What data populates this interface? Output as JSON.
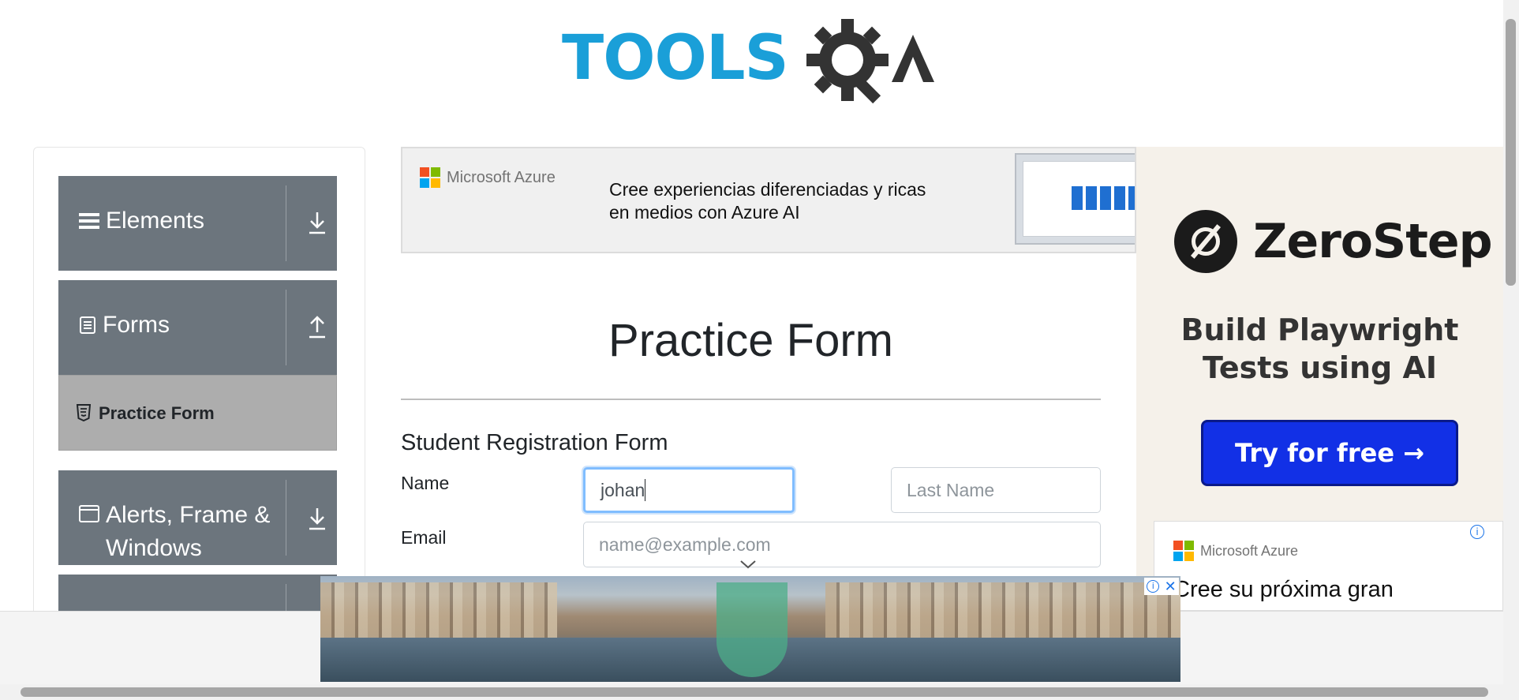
{
  "header": {
    "logo_text": "TOOLS",
    "logo_suffix": "QA"
  },
  "sidebar": {
    "groups": [
      {
        "label": "Elements",
        "icon": "hamburger-icon",
        "arrow": "download-arrow-icon"
      },
      {
        "label": "Forms",
        "icon": "document-icon",
        "arrow": "upload-arrow-icon"
      },
      {
        "label": "Alerts, Frame & Windows",
        "label_line1": "Alerts, Frame &",
        "label_line2": "Windows",
        "icon": "window-icon",
        "arrow": "download-arrow-icon"
      }
    ],
    "active_item": {
      "label": "Practice Form",
      "icon": "html5-icon"
    }
  },
  "ads": {
    "top": {
      "brand": "Microsoft Azure",
      "line1": "Cree experiencias diferenciadas y ricas",
      "line2": "en medios con Azure AI"
    },
    "right": {
      "brand": "ZeroStep",
      "headline_line1": "Build Playwright",
      "headline_line2": "Tests using AI",
      "cta": "Try for free →"
    },
    "right_small": {
      "brand": "Microsoft Azure",
      "text": "Cree su próxima gran"
    }
  },
  "main": {
    "title": "Practice Form",
    "form_title": "Student Registration Form",
    "name_label": "Name",
    "first_name_value": "johan",
    "last_name_placeholder": "Last Name",
    "email_label": "Email",
    "email_placeholder": "name@example.com"
  },
  "colors": {
    "sidebar_group": "#6c757d",
    "active_item": "#adadad",
    "logo_blue": "#1a9fd8",
    "zerostep_button": "#1230e6",
    "focus_border": "#80bdff"
  }
}
